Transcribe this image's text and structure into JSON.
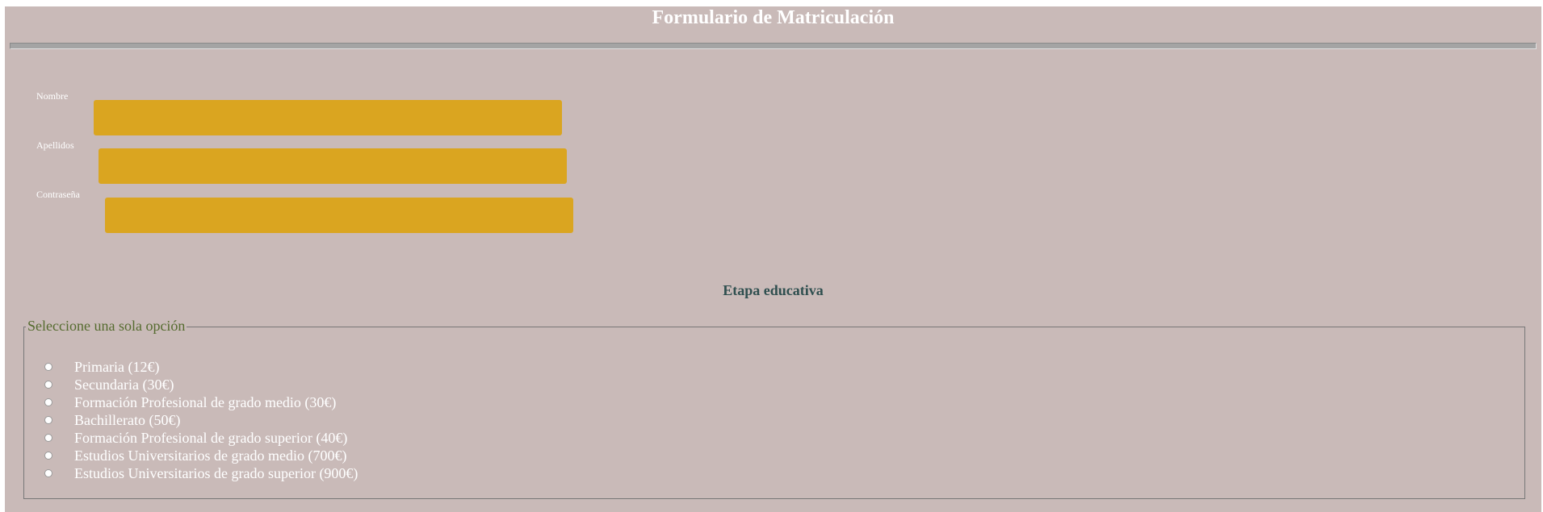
{
  "title": "Formulario de Matriculación",
  "fields": {
    "nombre": {
      "label": "Nombre",
      "value": ""
    },
    "apellidos": {
      "label": "Apellidos",
      "value": ""
    },
    "contrasena": {
      "label": "Contraseña",
      "value": ""
    }
  },
  "stage_heading": "Etapa educativa",
  "legend": "Seleccione una sola opción",
  "options": [
    "Primaria (12€)",
    "Secundaria (30€)",
    "Formación Profesional de grado medio (30€)",
    "Bachillerato (50€)",
    "Formación Profesional de grado superior (40€)",
    "Estudios Universitarios de grado medio (700€)",
    "Estudios Universitarios de grado superior (900€)"
  ],
  "colors": {
    "background": "#c9bab8",
    "input_fill": "#daa520",
    "heading": "#2f4f4f",
    "legend": "#556b2f"
  }
}
